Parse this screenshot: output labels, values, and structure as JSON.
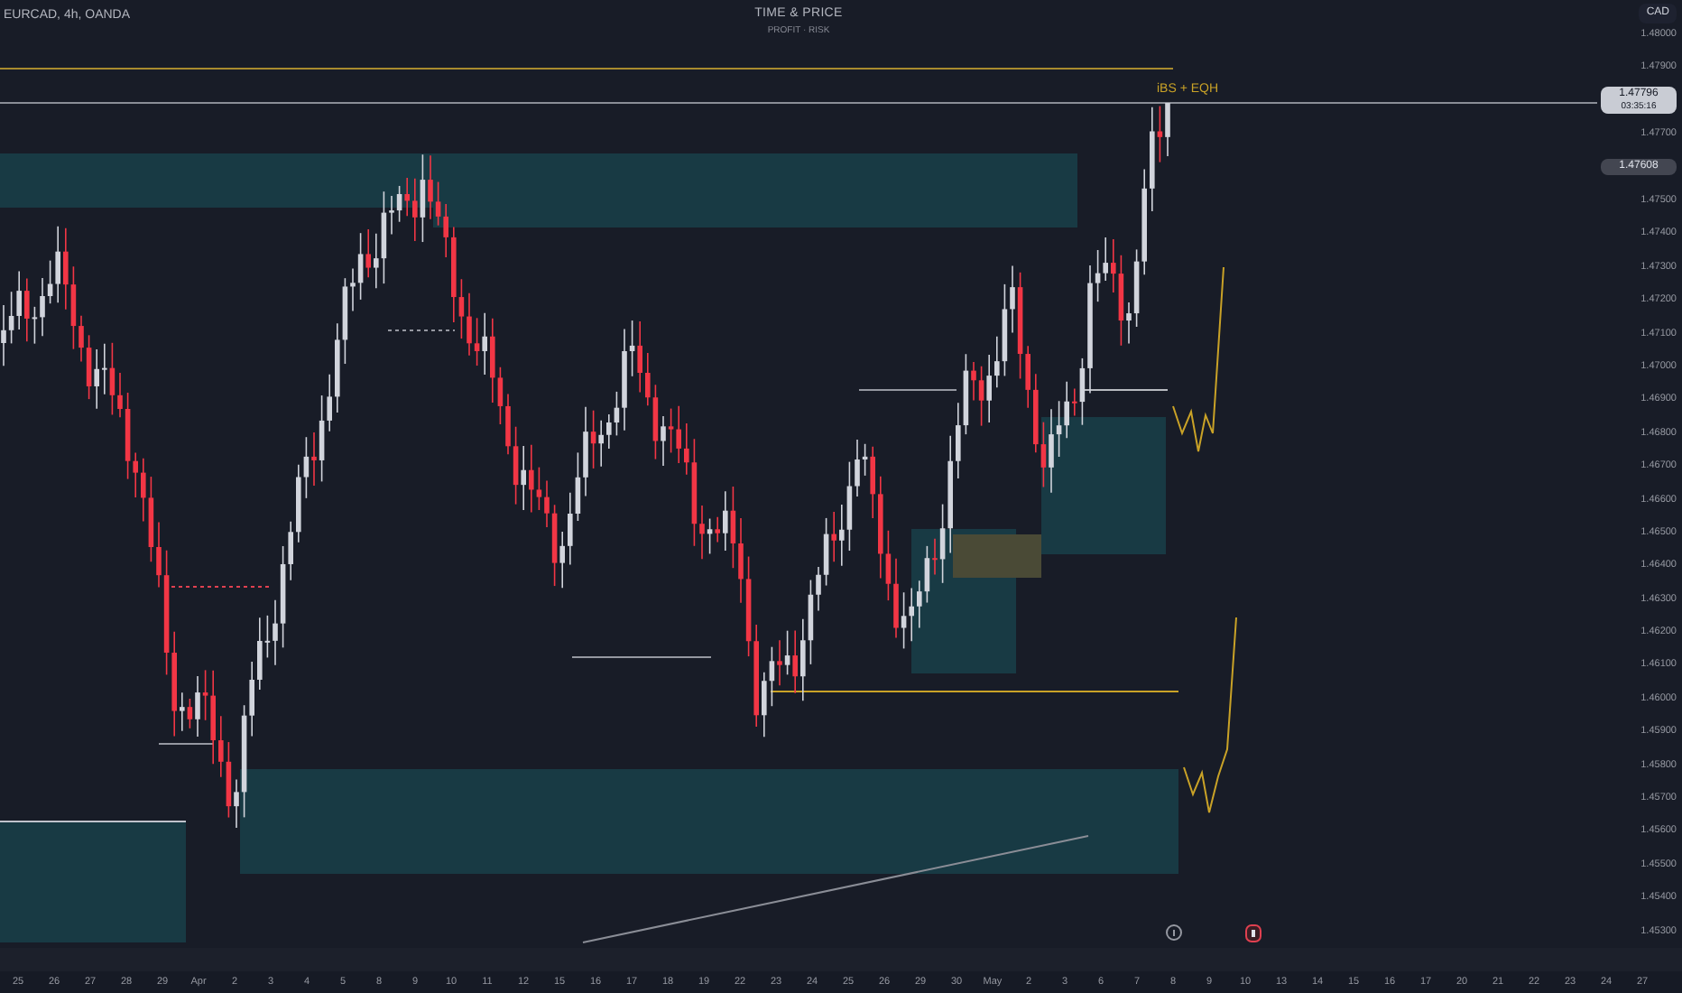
{
  "header": {
    "symbol": "EURCAD, 4h, OANDA",
    "title": "TIME & PRICE",
    "subtitle": "PROFIT · RISK"
  },
  "currency_button": "CAD",
  "annotation_label": "iBS + EQH",
  "price_axis": [
    {
      "kind": "label",
      "text": "1.48000"
    },
    {
      "kind": "label",
      "text": "1.47900"
    },
    {
      "kind": "last",
      "price": "1.47796",
      "countdown": "03:35:16"
    },
    {
      "kind": "label",
      "text": "1.47700"
    },
    {
      "kind": "mark",
      "price": "1.47608"
    },
    {
      "kind": "label",
      "text": "1.47500"
    },
    {
      "kind": "label",
      "text": "1.47400"
    },
    {
      "kind": "label",
      "text": "1.47300"
    },
    {
      "kind": "label",
      "text": "1.47200"
    },
    {
      "kind": "label",
      "text": "1.47100"
    },
    {
      "kind": "label",
      "text": "1.47000"
    },
    {
      "kind": "label",
      "text": "1.46900"
    },
    {
      "kind": "label",
      "text": "1.46800"
    },
    {
      "kind": "label",
      "text": "1.46700"
    },
    {
      "kind": "label",
      "text": "1.46600"
    },
    {
      "kind": "label",
      "text": "1.46500"
    },
    {
      "kind": "label",
      "text": "1.46400"
    },
    {
      "kind": "label",
      "text": "1.46300"
    },
    {
      "kind": "label",
      "text": "1.46200"
    },
    {
      "kind": "label",
      "text": "1.46100"
    },
    {
      "kind": "label",
      "text": "1.46000"
    },
    {
      "kind": "label",
      "text": "1.45900"
    },
    {
      "kind": "label",
      "text": "1.45800"
    },
    {
      "kind": "label",
      "text": "1.45700"
    },
    {
      "kind": "label",
      "text": "1.45600"
    },
    {
      "kind": "label",
      "text": "1.45500"
    },
    {
      "kind": "label",
      "text": "1.45400"
    },
    {
      "kind": "label",
      "text": "1.45300"
    }
  ],
  "time_axis": [
    "25",
    "26",
    "27",
    "28",
    "29",
    "Apr",
    "2",
    "3",
    "4",
    "5",
    "8",
    "9",
    "10",
    "11",
    "12",
    "15",
    "16",
    "17",
    "18",
    "19",
    "22",
    "23",
    "24",
    "25",
    "26",
    "29",
    "30",
    "May",
    "2",
    "3",
    "6",
    "7",
    "8",
    "9",
    "10",
    "13",
    "14",
    "15",
    "16",
    "17",
    "20",
    "21",
    "22",
    "23",
    "24",
    "27"
  ]
}
